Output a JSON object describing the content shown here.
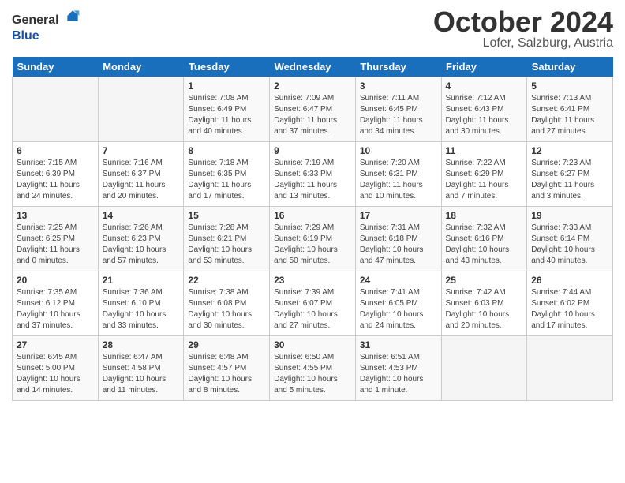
{
  "header": {
    "logo_general": "General",
    "logo_blue": "Blue",
    "month": "October 2024",
    "location": "Lofer, Salzburg, Austria"
  },
  "weekdays": [
    "Sunday",
    "Monday",
    "Tuesday",
    "Wednesday",
    "Thursday",
    "Friday",
    "Saturday"
  ],
  "weeks": [
    [
      {
        "day": "",
        "sunrise": "",
        "sunset": "",
        "daylight": "",
        "empty": true
      },
      {
        "day": "",
        "sunrise": "",
        "sunset": "",
        "daylight": "",
        "empty": true
      },
      {
        "day": "1",
        "sunrise": "Sunrise: 7:08 AM",
        "sunset": "Sunset: 6:49 PM",
        "daylight": "Daylight: 11 hours and 40 minutes."
      },
      {
        "day": "2",
        "sunrise": "Sunrise: 7:09 AM",
        "sunset": "Sunset: 6:47 PM",
        "daylight": "Daylight: 11 hours and 37 minutes."
      },
      {
        "day": "3",
        "sunrise": "Sunrise: 7:11 AM",
        "sunset": "Sunset: 6:45 PM",
        "daylight": "Daylight: 11 hours and 34 minutes."
      },
      {
        "day": "4",
        "sunrise": "Sunrise: 7:12 AM",
        "sunset": "Sunset: 6:43 PM",
        "daylight": "Daylight: 11 hours and 30 minutes."
      },
      {
        "day": "5",
        "sunrise": "Sunrise: 7:13 AM",
        "sunset": "Sunset: 6:41 PM",
        "daylight": "Daylight: 11 hours and 27 minutes."
      }
    ],
    [
      {
        "day": "6",
        "sunrise": "Sunrise: 7:15 AM",
        "sunset": "Sunset: 6:39 PM",
        "daylight": "Daylight: 11 hours and 24 minutes."
      },
      {
        "day": "7",
        "sunrise": "Sunrise: 7:16 AM",
        "sunset": "Sunset: 6:37 PM",
        "daylight": "Daylight: 11 hours and 20 minutes."
      },
      {
        "day": "8",
        "sunrise": "Sunrise: 7:18 AM",
        "sunset": "Sunset: 6:35 PM",
        "daylight": "Daylight: 11 hours and 17 minutes."
      },
      {
        "day": "9",
        "sunrise": "Sunrise: 7:19 AM",
        "sunset": "Sunset: 6:33 PM",
        "daylight": "Daylight: 11 hours and 13 minutes."
      },
      {
        "day": "10",
        "sunrise": "Sunrise: 7:20 AM",
        "sunset": "Sunset: 6:31 PM",
        "daylight": "Daylight: 11 hours and 10 minutes."
      },
      {
        "day": "11",
        "sunrise": "Sunrise: 7:22 AM",
        "sunset": "Sunset: 6:29 PM",
        "daylight": "Daylight: 11 hours and 7 minutes."
      },
      {
        "day": "12",
        "sunrise": "Sunrise: 7:23 AM",
        "sunset": "Sunset: 6:27 PM",
        "daylight": "Daylight: 11 hours and 3 minutes."
      }
    ],
    [
      {
        "day": "13",
        "sunrise": "Sunrise: 7:25 AM",
        "sunset": "Sunset: 6:25 PM",
        "daylight": "Daylight: 11 hours and 0 minutes."
      },
      {
        "day": "14",
        "sunrise": "Sunrise: 7:26 AM",
        "sunset": "Sunset: 6:23 PM",
        "daylight": "Daylight: 10 hours and 57 minutes."
      },
      {
        "day": "15",
        "sunrise": "Sunrise: 7:28 AM",
        "sunset": "Sunset: 6:21 PM",
        "daylight": "Daylight: 10 hours and 53 minutes."
      },
      {
        "day": "16",
        "sunrise": "Sunrise: 7:29 AM",
        "sunset": "Sunset: 6:19 PM",
        "daylight": "Daylight: 10 hours and 50 minutes."
      },
      {
        "day": "17",
        "sunrise": "Sunrise: 7:31 AM",
        "sunset": "Sunset: 6:18 PM",
        "daylight": "Daylight: 10 hours and 47 minutes."
      },
      {
        "day": "18",
        "sunrise": "Sunrise: 7:32 AM",
        "sunset": "Sunset: 6:16 PM",
        "daylight": "Daylight: 10 hours and 43 minutes."
      },
      {
        "day": "19",
        "sunrise": "Sunrise: 7:33 AM",
        "sunset": "Sunset: 6:14 PM",
        "daylight": "Daylight: 10 hours and 40 minutes."
      }
    ],
    [
      {
        "day": "20",
        "sunrise": "Sunrise: 7:35 AM",
        "sunset": "Sunset: 6:12 PM",
        "daylight": "Daylight: 10 hours and 37 minutes."
      },
      {
        "day": "21",
        "sunrise": "Sunrise: 7:36 AM",
        "sunset": "Sunset: 6:10 PM",
        "daylight": "Daylight: 10 hours and 33 minutes."
      },
      {
        "day": "22",
        "sunrise": "Sunrise: 7:38 AM",
        "sunset": "Sunset: 6:08 PM",
        "daylight": "Daylight: 10 hours and 30 minutes."
      },
      {
        "day": "23",
        "sunrise": "Sunrise: 7:39 AM",
        "sunset": "Sunset: 6:07 PM",
        "daylight": "Daylight: 10 hours and 27 minutes."
      },
      {
        "day": "24",
        "sunrise": "Sunrise: 7:41 AM",
        "sunset": "Sunset: 6:05 PM",
        "daylight": "Daylight: 10 hours and 24 minutes."
      },
      {
        "day": "25",
        "sunrise": "Sunrise: 7:42 AM",
        "sunset": "Sunset: 6:03 PM",
        "daylight": "Daylight: 10 hours and 20 minutes."
      },
      {
        "day": "26",
        "sunrise": "Sunrise: 7:44 AM",
        "sunset": "Sunset: 6:02 PM",
        "daylight": "Daylight: 10 hours and 17 minutes."
      }
    ],
    [
      {
        "day": "27",
        "sunrise": "Sunrise: 6:45 AM",
        "sunset": "Sunset: 5:00 PM",
        "daylight": "Daylight: 10 hours and 14 minutes."
      },
      {
        "day": "28",
        "sunrise": "Sunrise: 6:47 AM",
        "sunset": "Sunset: 4:58 PM",
        "daylight": "Daylight: 10 hours and 11 minutes."
      },
      {
        "day": "29",
        "sunrise": "Sunrise: 6:48 AM",
        "sunset": "Sunset: 4:57 PM",
        "daylight": "Daylight: 10 hours and 8 minutes."
      },
      {
        "day": "30",
        "sunrise": "Sunrise: 6:50 AM",
        "sunset": "Sunset: 4:55 PM",
        "daylight": "Daylight: 10 hours and 5 minutes."
      },
      {
        "day": "31",
        "sunrise": "Sunrise: 6:51 AM",
        "sunset": "Sunset: 4:53 PM",
        "daylight": "Daylight: 10 hours and 1 minute."
      },
      {
        "day": "",
        "sunrise": "",
        "sunset": "",
        "daylight": "",
        "empty": true
      },
      {
        "day": "",
        "sunrise": "",
        "sunset": "",
        "daylight": "",
        "empty": true
      }
    ]
  ]
}
